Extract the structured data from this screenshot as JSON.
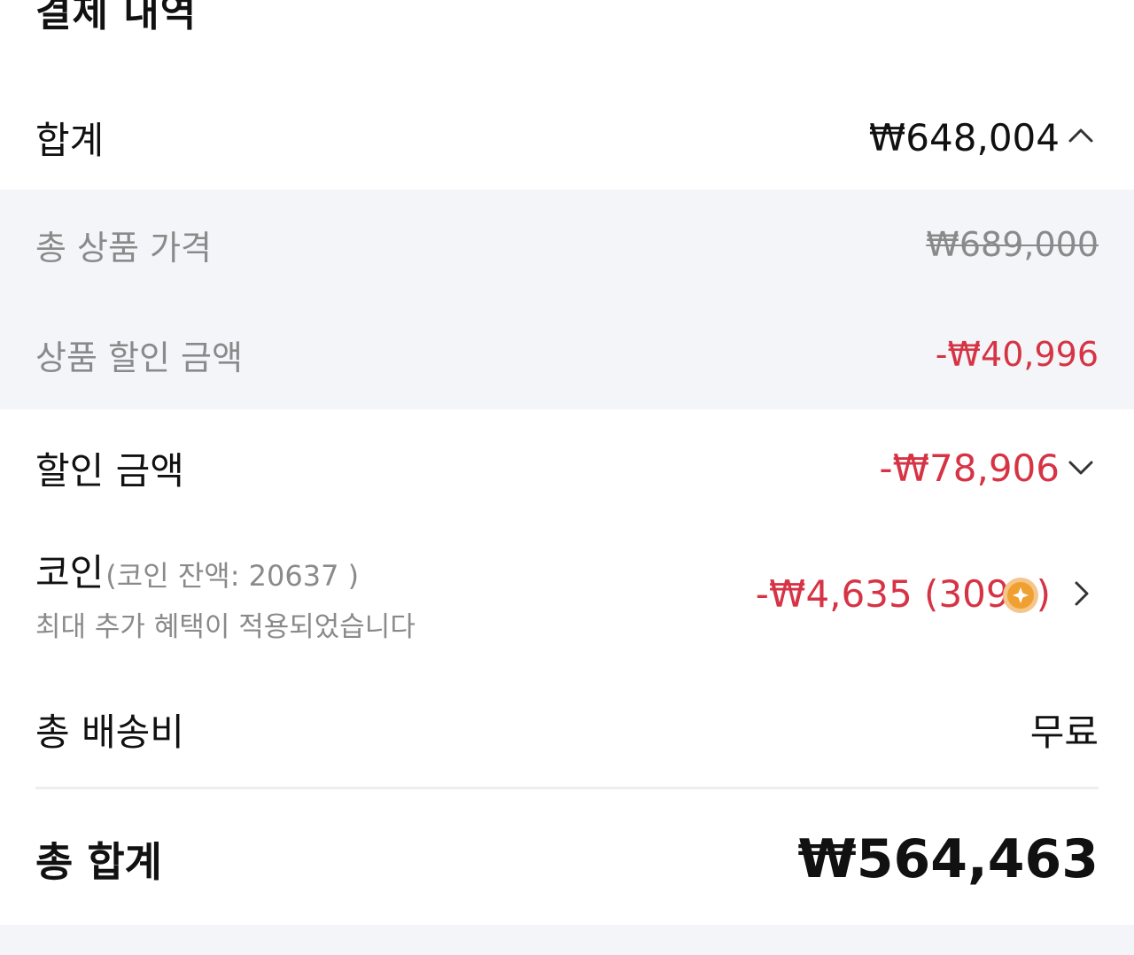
{
  "section": {
    "title": "결제 내역"
  },
  "summary": {
    "label": "합계",
    "value": "₩648,004",
    "toggle_icon": "chevron-up-icon"
  },
  "breakdown": {
    "items": [
      {
        "label": "총 상품 가격",
        "value": "₩689,000"
      },
      {
        "label": "상품 할인 금액",
        "value": "-₩40,996"
      }
    ]
  },
  "discount": {
    "label": "할인 금액",
    "value": "-₩78,906",
    "toggle_icon": "chevron-down-icon"
  },
  "coin": {
    "label": "코인",
    "balance": "(코인 잔액: 20637 )",
    "note": "최대 추가 혜택이 적용되었습니다",
    "value_prefix": "-₩4,635 (309",
    "value_suffix": ")",
    "icon": "coin-icon",
    "arrow_icon": "chevron-right-icon"
  },
  "shipping": {
    "label": "총 배송비",
    "value": "무료"
  },
  "total": {
    "label": "총 합계",
    "value": "₩564,463"
  },
  "colors": {
    "discount_red": "#d63445",
    "muted_gray": "#8a8a8a",
    "panel_bg": "#f3f5f8",
    "coin_orange": "#f0a030"
  }
}
